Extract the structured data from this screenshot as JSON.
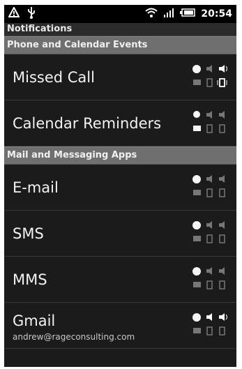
{
  "status": {
    "time": "20:54"
  },
  "header": {
    "title": "Notifications"
  },
  "sections": [
    {
      "title": "Phone and Calendar Events"
    },
    {
      "title": "Mail and Messaging Apps"
    }
  ],
  "items": [
    {
      "label": "Missed Call"
    },
    {
      "label": "Calendar Reminders"
    },
    {
      "label": "E-mail"
    },
    {
      "label": "SMS"
    },
    {
      "label": "MMS"
    },
    {
      "label": "Gmail",
      "sub": "andrew@rageconsulting.com"
    }
  ]
}
